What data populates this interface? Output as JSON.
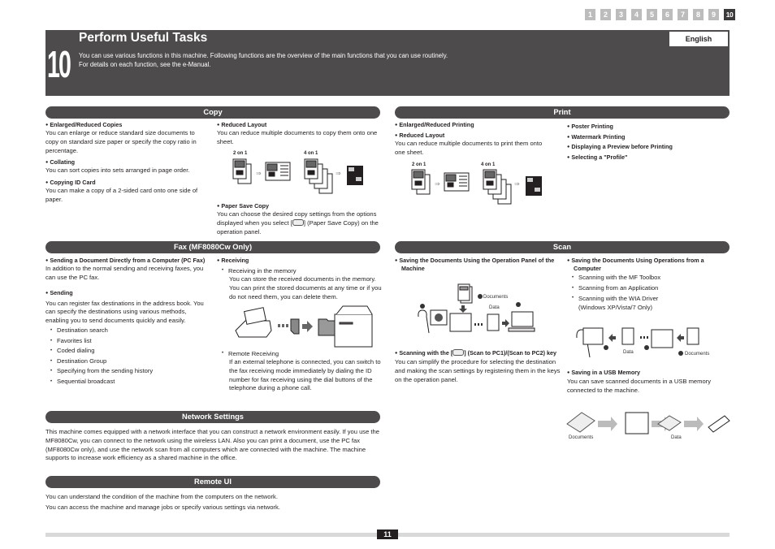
{
  "chapter_tabs": [
    "1",
    "2",
    "3",
    "4",
    "5",
    "6",
    "7",
    "8",
    "9",
    "10"
  ],
  "active_tab": "10",
  "header": {
    "chapter_number": "10",
    "title": "Perform Useful Tasks",
    "intro_line1": "You can use various functions in this machine. Following functions are the overview of the main functions that you can use routinely.",
    "intro_line2": "For details on each function, see the e-Manual.",
    "language_button": "English"
  },
  "copy": {
    "title": "Copy",
    "enlarged_h": "Enlarged/Reduced Copies",
    "enlarged_p": "You can enlarge or reduce standard size documents to copy on standard size paper or specify the copy ratio in percentage.",
    "collating_h": "Collating",
    "collating_p": "You can sort copies into sets arranged in page order.",
    "idcard_h": "Copying ID Card",
    "idcard_p": "You can make a copy of a 2-sided card onto one side of paper.",
    "reduced_h": "Reduced Layout",
    "reduced_p": "You can reduce multiple documents to copy them onto one sheet.",
    "label_2on1": "2 on 1",
    "label_4on1": "4 on 1",
    "papersave_h": "Paper Save Copy",
    "papersave_p1": "You can choose the desired copy settings from the options displayed when you select [",
    "papersave_p2": "] (Paper Save Copy) on the operation panel."
  },
  "print": {
    "title": "Print",
    "enlarged_h": "Enlarged/Reduced Printing",
    "reduced_h": "Reduced Layout",
    "reduced_p": "You can reduce multiple documents to print them onto one sheet.",
    "label_2on1": "2 on 1",
    "label_4on1": "4 on 1",
    "poster_h": "Poster Printing",
    "watermark_h": "Watermark Printing",
    "preview_h": "Displaying a Preview before Printing",
    "profile_h": "Selecting a \"Profile\""
  },
  "fax": {
    "title": "Fax (MF8080Cw Only)",
    "pcfax_h": "Sending a Document Directly from a Computer (PC Fax)",
    "pcfax_p": "In addition to the normal sending and receiving faxes, you can use the PC fax.",
    "sending_h": "Sending",
    "sending_p": "You can register fax destinations in the address book. You can specify the destinations using various methods, enabling you to send documents quickly and easily.",
    "sending_items": [
      "Destination search",
      "Favorites list",
      "Coded dialing",
      "Destination Group",
      "Specifying from the sending history",
      "Sequential broadcast"
    ],
    "receiving_h": "Receiving",
    "memory_item": "Receiving in the memory",
    "memory_p": "You can store the received documents in the memory. You can print the stored documents at any time or if you do not need them, you can delete them.",
    "remote_item": "Remote Receiving",
    "remote_p": "If an external telephone is connected, you can switch to the fax receiving mode immediately by dialing the ID number for fax receiving using the dial buttons of the telephone during a phone call."
  },
  "scan": {
    "title": "Scan",
    "panel_h": "Saving the Documents Using the Operation Panel of the Machine",
    "fig1_documents": "Documents",
    "fig1_data": "Data",
    "key_h1": "Scanning with the [",
    "key_h2": "] (Scan to PC1)/(Scan to PC2) key",
    "key_p": "You can simplify the procedure for selecting the destination and making the scan settings by registering them in the keys on the operation panel.",
    "computer_h": "Saving the Documents Using Operations from a Computer",
    "computer_items": [
      "Scanning with the MF Toolbox",
      "Scanning from an Application",
      "Scanning with the WIA Driver (Windows XP/Vista/7 Only)"
    ],
    "fig2_data": "Data",
    "fig2_documents": "Documents",
    "usb_h": "Saving in a USB Memory",
    "usb_p": "You can save scanned documents in a USB memory connected to the machine.",
    "fig3_documents": "Documents",
    "fig3_data": "Data",
    "step1": "1",
    "step2": "2",
    "step3": "3"
  },
  "network": {
    "title": "Network Settings",
    "p": "This machine comes equipped with a network interface that you can construct a network environment easily. If you use the MF8080Cw, you can connect to the network using the wireless LAN. Also you can print a document, use the PC fax (MF8080Cw only), and use the network scan from all computers which are connected with the machine. The machine supports to increase work efficiency as a shared machine in the office."
  },
  "remote_ui": {
    "title": "Remote UI",
    "p1": "You can understand the condition of the machine from the computers on the network.",
    "p2": "You can access the machine and manage jobs or specify various settings via network."
  },
  "footer": {
    "page_number": "11"
  }
}
